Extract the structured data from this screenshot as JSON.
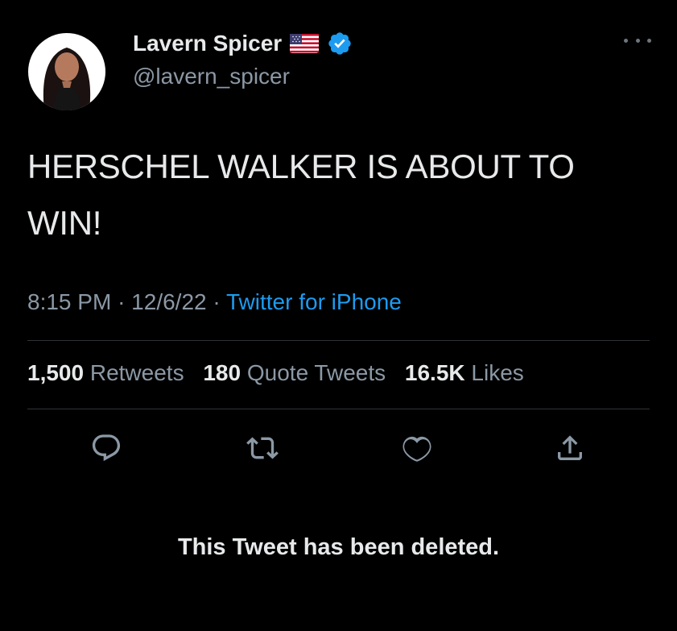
{
  "author": {
    "display_name": "Lavern Spicer",
    "handle": "@lavern_spicer",
    "flag_icon": "us-flag-icon",
    "verified_icon": "verified-badge-icon"
  },
  "tweet": {
    "text": "HERSCHEL WALKER IS ABOUT TO WIN!",
    "time": "8:15 PM",
    "separator": "·",
    "date": "12/6/22",
    "source": "Twitter for iPhone"
  },
  "stats": {
    "retweets_count": "1,500",
    "retweets_label": "Retweets",
    "quotes_count": "180",
    "quotes_label": "Quote Tweets",
    "likes_count": "16.5K",
    "likes_label": "Likes"
  },
  "actions": [
    "reply-icon",
    "retweet-icon",
    "like-icon",
    "share-icon"
  ],
  "notice": "This Tweet has been deleted.",
  "colors": {
    "background": "#000000",
    "primary_text": "#e7e9ea",
    "secondary_text": "#8b98a5",
    "accent": "#1d9bf0",
    "divider": "#2f3336"
  }
}
